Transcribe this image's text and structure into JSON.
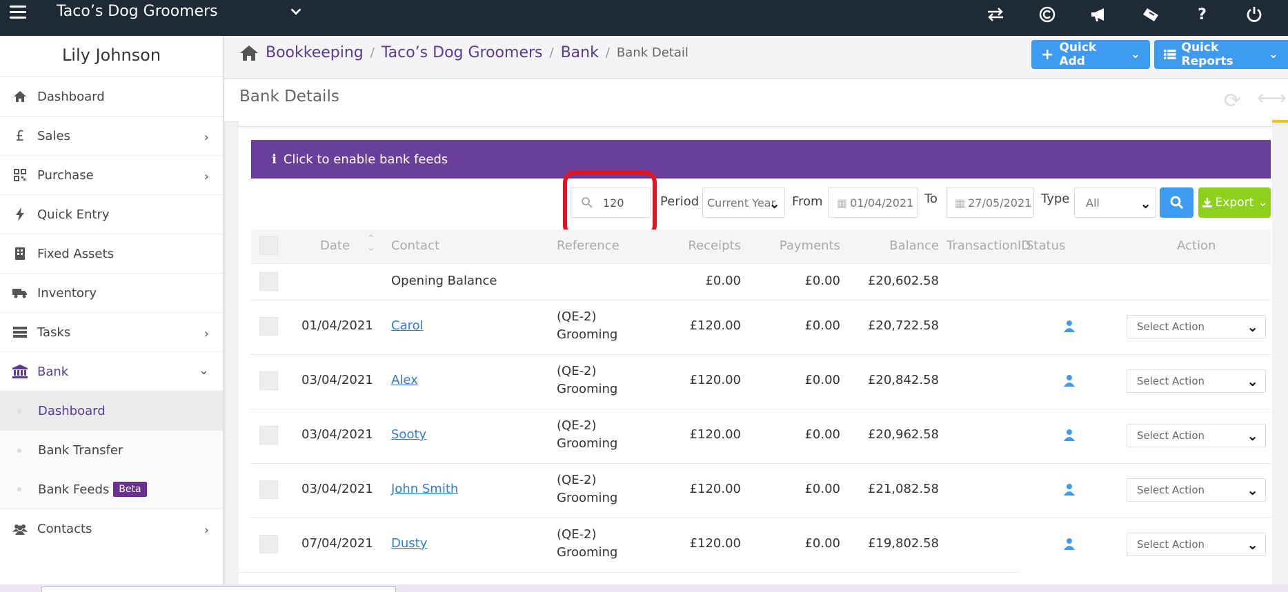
{
  "topbar": {
    "org_name": "Taco’s Dog Groomers",
    "icons": [
      "transfer-icon",
      "copyright-icon",
      "megaphone-icon",
      "ticket-icon",
      "help-icon",
      "power-icon"
    ],
    "help_label": "?"
  },
  "sidebar": {
    "user_name": "Lily Johnson",
    "items": [
      {
        "label": "Dashboard",
        "icon": "home-icon",
        "chevron": false
      },
      {
        "label": "Sales",
        "icon": "pound-icon",
        "chevron": true
      },
      {
        "label": "Purchase",
        "icon": "qr-icon",
        "chevron": true
      },
      {
        "label": "Quick Entry",
        "icon": "bolt-icon",
        "chevron": false
      },
      {
        "label": "Fixed Assets",
        "icon": "building-icon",
        "chevron": false
      },
      {
        "label": "Inventory",
        "icon": "truck-icon",
        "chevron": false
      },
      {
        "label": "Tasks",
        "icon": "tasks-icon",
        "chevron": true
      },
      {
        "label": "Bank",
        "icon": "bank-icon",
        "chevron": true,
        "expanded": true
      }
    ],
    "bank_sub": [
      {
        "label": "Dashboard",
        "current": true
      },
      {
        "label": "Bank Transfer"
      },
      {
        "label": "Bank Feeds",
        "badge": "Beta"
      }
    ],
    "contacts": {
      "label": "Contacts",
      "icon": "users-icon"
    }
  },
  "breadcrumb": {
    "items": [
      "Bookkeeping",
      "Taco’s Dog Groomers",
      "Bank"
    ],
    "current": "Bank Detail"
  },
  "header_buttons": {
    "quick_add": "Quick Add",
    "quick_reports": "Quick Reports"
  },
  "panel": {
    "title": "Bank Details"
  },
  "banner": {
    "text": "Click to enable bank feeds"
  },
  "filters": {
    "search_value": "120",
    "period_label": "Period",
    "period_value": "Current Year",
    "from_label": "From",
    "from_value": "01/04/2021",
    "to_label": "To",
    "to_value": "27/05/2021",
    "type_label": "Type",
    "type_value": "All",
    "export_label": "Export"
  },
  "table": {
    "headers": {
      "date": "Date",
      "contact": "Contact",
      "reference": "Reference",
      "receipts": "Receipts",
      "payments": "Payments",
      "balance": "Balance",
      "transaction_id": "TransactionID",
      "status": "Status",
      "action": "Action"
    },
    "opening": {
      "label": "Opening Balance",
      "receipts": "£0.00",
      "payments": "£0.00",
      "balance": "£20,602.58"
    },
    "rows": [
      {
        "date": "01/04/2021",
        "contact": "Carol",
        "ref1": "(QE-2)",
        "ref2": "Grooming",
        "receipts": "£120.00",
        "payments": "£0.00",
        "balance": "£20,722.58",
        "action": "Select Action"
      },
      {
        "date": "03/04/2021",
        "contact": "Alex",
        "ref1": "(QE-2)",
        "ref2": "Grooming",
        "receipts": "£120.00",
        "payments": "£0.00",
        "balance": "£20,842.58",
        "action": "Select Action"
      },
      {
        "date": "03/04/2021",
        "contact": "Sooty",
        "ref1": "(QE-2)",
        "ref2": "Grooming",
        "receipts": "£120.00",
        "payments": "£0.00",
        "balance": "£20,962.58",
        "action": "Select Action"
      },
      {
        "date": "03/04/2021",
        "contact": "John Smith",
        "ref1": "(QE-2)",
        "ref2": "Grooming",
        "receipts": "£120.00",
        "payments": "£0.00",
        "balance": "£21,082.58",
        "action": "Select Action"
      },
      {
        "date": "07/04/2021",
        "contact": "Dusty",
        "ref1": "(QE-2)",
        "ref2": "Grooming",
        "receipts": "£120.00",
        "payments": "£0.00",
        "balance": "£19,802.58",
        "action": "Select Action"
      }
    ]
  },
  "colors": {
    "brand_purple": "#6a3f9b",
    "accent_blue": "#3d9bf2",
    "export_green": "#8ed11c",
    "highlight_red": "#e4141e",
    "topbar_dark": "#1f2a37"
  }
}
